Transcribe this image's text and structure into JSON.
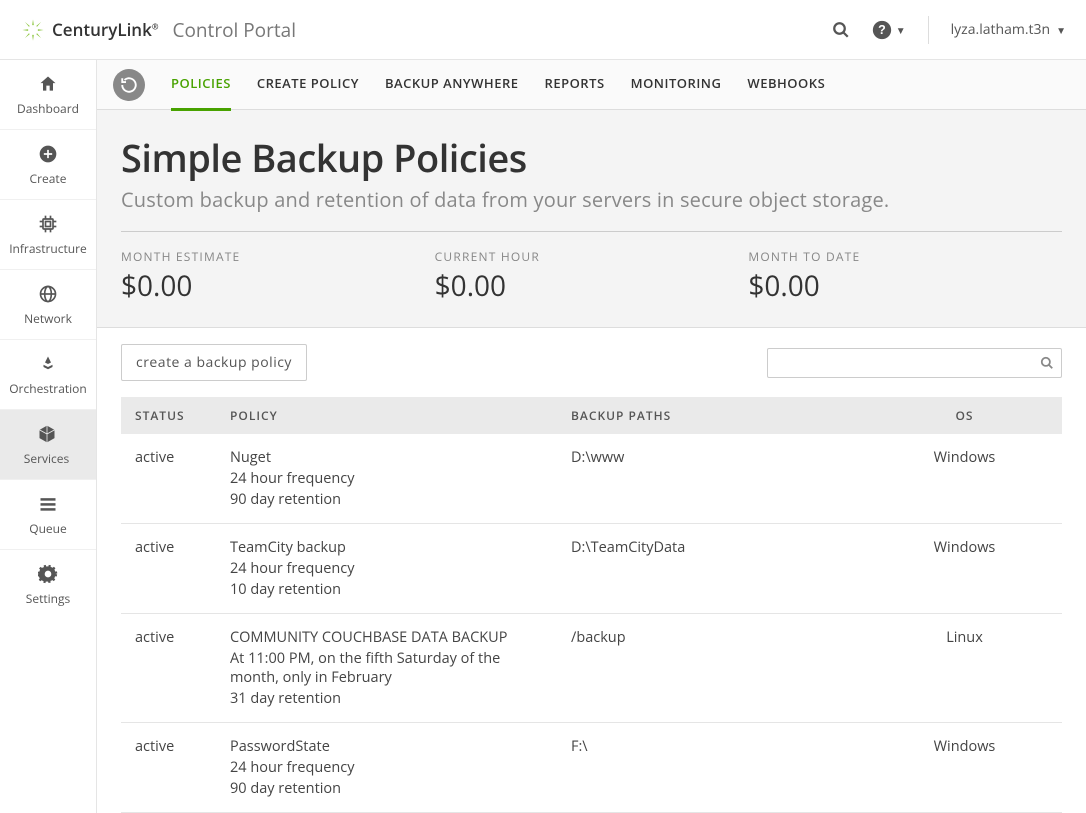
{
  "brand": "CenturyLink",
  "portal_title": "Control Portal",
  "user": "lyza.latham.t3n",
  "sidebar": {
    "items": [
      {
        "label": "Dashboard",
        "icon": "home"
      },
      {
        "label": "Create",
        "icon": "plus-circle"
      },
      {
        "label": "Infrastructure",
        "icon": "cpu"
      },
      {
        "label": "Network",
        "icon": "globe"
      },
      {
        "label": "Orchestration",
        "icon": "layers"
      },
      {
        "label": "Services",
        "icon": "box"
      },
      {
        "label": "Queue",
        "icon": "list"
      },
      {
        "label": "Settings",
        "icon": "gear"
      }
    ],
    "active_index": 5
  },
  "tabs": {
    "items": [
      {
        "label": "POLICIES"
      },
      {
        "label": "CREATE POLICY"
      },
      {
        "label": "BACKUP ANYWHERE"
      },
      {
        "label": "REPORTS"
      },
      {
        "label": "MONITORING"
      },
      {
        "label": "WEBHOOKS"
      }
    ],
    "active_index": 0
  },
  "page": {
    "title": "Simple Backup Policies",
    "subtitle": "Custom backup and retention of data from your servers in secure object storage."
  },
  "stats": [
    {
      "label": "MONTH ESTIMATE",
      "value": "$0.00"
    },
    {
      "label": "CURRENT HOUR",
      "value": "$0.00"
    },
    {
      "label": "MONTH TO DATE",
      "value": "$0.00"
    }
  ],
  "actions": {
    "create_label": "create a backup policy",
    "search_placeholder": ""
  },
  "table": {
    "headers": [
      "STATUS",
      "POLICY",
      "BACKUP PATHS",
      "OS"
    ],
    "rows": [
      {
        "status": "active",
        "name": "Nuget",
        "line2": "24 hour frequency",
        "line3": "90 day retention",
        "paths": "D:\\www",
        "os": "Windows"
      },
      {
        "status": "active",
        "name": "TeamCity backup",
        "line2": "24 hour frequency",
        "line3": "10 day retention",
        "paths": "D:\\TeamCityData",
        "os": "Windows"
      },
      {
        "status": "active",
        "name": "COMMUNITY COUCHBASE DATA BACKUP",
        "line2": "At 11:00 PM, on the fifth Saturday of the month, only in February",
        "line3": "31 day retention",
        "paths": "/backup",
        "os": "Linux"
      },
      {
        "status": "active",
        "name": "PasswordState",
        "line2": "24 hour frequency",
        "line3": "90 day retention",
        "paths": "F:\\",
        "os": "Windows"
      }
    ]
  }
}
